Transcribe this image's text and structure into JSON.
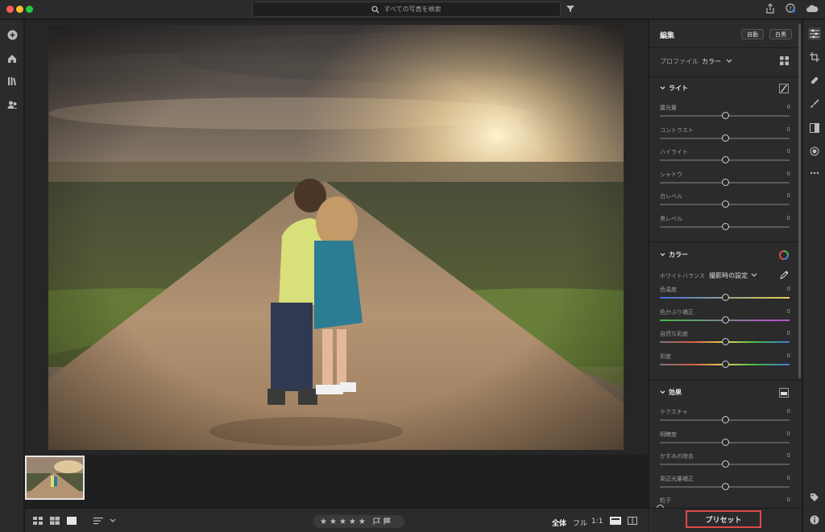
{
  "search": {
    "placeholder": "すべての写真を検索"
  },
  "editor": {
    "title": "編集",
    "auto_label": "自動",
    "bw_label": "白黒",
    "profile_label": "プロファイル",
    "profile_value": "カラー",
    "sections": {
      "light": {
        "title": "ライト",
        "sliders": [
          {
            "label": "露光量",
            "value": "0",
            "position": 0.5
          },
          {
            "label": "コントラスト",
            "value": "0",
            "position": 0.5
          },
          {
            "label": "ハイライト",
            "value": "0",
            "position": 0.5
          },
          {
            "label": "シャドウ",
            "value": "0",
            "position": 0.5
          },
          {
            "label": "白レベル",
            "value": "0",
            "position": 0.5
          },
          {
            "label": "黒レベル",
            "value": "0",
            "position": 0.5
          }
        ]
      },
      "color": {
        "title": "カラー",
        "wb_label": "ホワイトバランス",
        "wb_value": "撮影時の設定",
        "sliders": [
          {
            "label": "色温度",
            "value": "0",
            "position": 0.5
          },
          {
            "label": "色かぶり補正",
            "value": "0",
            "position": 0.5
          },
          {
            "label": "自然な彩度",
            "value": "0",
            "position": 0.5
          },
          {
            "label": "彩度",
            "value": "0",
            "position": 0.5
          }
        ]
      },
      "effects": {
        "title": "効果",
        "sliders": [
          {
            "label": "テクスチャ",
            "value": "0",
            "position": 0.5
          },
          {
            "label": "明瞭度",
            "value": "0",
            "position": 0.5
          },
          {
            "label": "かすみの除去",
            "value": "0",
            "position": 0.5
          },
          {
            "label": "周辺光量補正",
            "value": "0",
            "position": 0.5
          },
          {
            "label": "粒子",
            "value": "0",
            "position": 0.0
          }
        ]
      }
    }
  },
  "bottombar": {
    "view_all": "全体",
    "view_full": "フル",
    "view_1to1": "1:1",
    "stars": [
      "★",
      "★",
      "★",
      "★",
      "★"
    ]
  },
  "preset_label": "プリセット",
  "colors": {
    "accent_red": "#e04a4a",
    "panel_bg": "#2b2b2b",
    "dark_bg": "#1e1e1e"
  }
}
